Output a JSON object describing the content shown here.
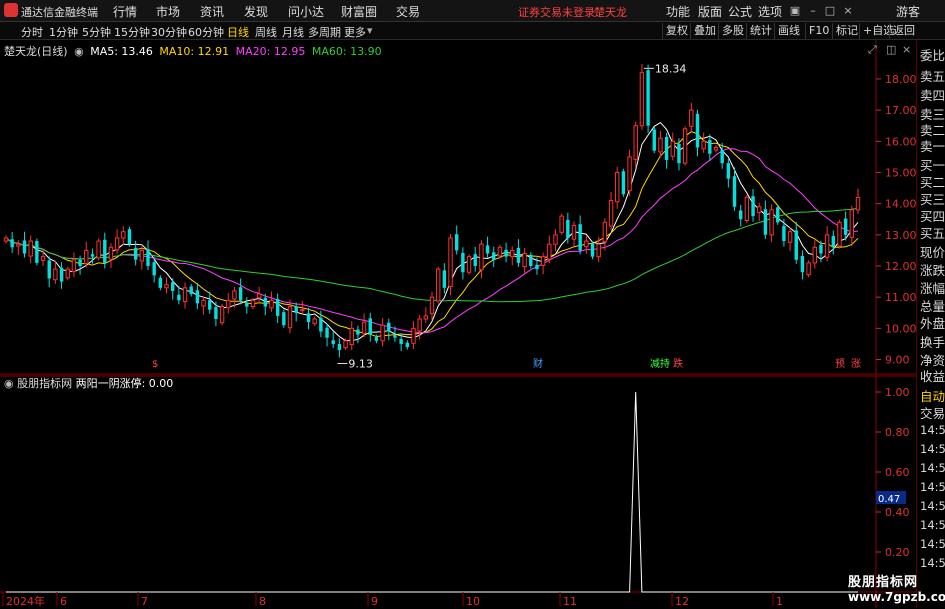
{
  "app": {
    "title": "通达信金融终端",
    "notice": "证券交易未登录",
    "stock_name": "楚天龙",
    "menu": [
      "行情",
      "市场",
      "资讯",
      "发现",
      "问小达",
      "财富圈",
      "交易"
    ],
    "right_menu": [
      "功能",
      "版面",
      "公式",
      "选项"
    ],
    "guest": "游客"
  },
  "periods": [
    "分时",
    "1分钟",
    "5分钟",
    "15分钟",
    "30分钟",
    "60分钟",
    "日线",
    "周线",
    "月线",
    "多周期",
    "更多"
  ],
  "active_period": "日线",
  "toolbar": [
    "复权",
    "叠加",
    "多股",
    "统计",
    "画线",
    "F10",
    "标记",
    "+自选",
    "返回"
  ],
  "legend": {
    "label": "楚天龙(日线)",
    "ma": [
      {
        "label": "MA5: 13.46",
        "color": "#ffffff"
      },
      {
        "label": "MA10: 12.91",
        "color": "#ffd700"
      },
      {
        "label": "MA20: 12.95",
        "color": "#ff40ff"
      },
      {
        "label": "MA60: 13.90",
        "color": "#32cd32"
      }
    ]
  },
  "price_axis": {
    "min": 8.6,
    "max": 18.8,
    "ticks": [
      "18.00",
      "17.00",
      "16.00",
      "15.00",
      "14.00",
      "13.00",
      "12.00",
      "11.00",
      "10.00",
      "9.00"
    ]
  },
  "annotations": {
    "high": "18.34",
    "low": "9.13"
  },
  "markers": [
    {
      "text": "$",
      "color": "#ff4040"
    },
    {
      "text": "财",
      "color": "#40a0ff"
    },
    {
      "text": "减持",
      "color": "#40ff40"
    },
    {
      "text": "跌",
      "color": "#ff4040"
    },
    {
      "text": "预",
      "color": "#ff4040"
    },
    {
      "text": "涨",
      "color": "#ff4040"
    }
  ],
  "indicator": {
    "name": "股朋指标网",
    "line": "两阳一阴涨停: 0.00",
    "ticks": [
      "1.00",
      "0.80",
      "0.60",
      "0.40",
      "0.20"
    ],
    "current": "0.47"
  },
  "date_axis": {
    "labels": [
      "2024年",
      "6",
      "7",
      "8",
      "9",
      "10",
      "11",
      "12",
      "1"
    ]
  },
  "right_panel": {
    "upper": [
      "委比",
      "卖五",
      "卖四",
      "卖三",
      "卖二",
      "卖一",
      "买一",
      "买二",
      "买三",
      "买四",
      "买五",
      "现价",
      "涨跌",
      "涨幅",
      "总量",
      "外盘",
      "换手",
      "净资",
      "收益"
    ],
    "lower": [
      "自动",
      "交易"
    ],
    "times": [
      "14:56",
      "14:56",
      "14:56",
      "14:56",
      "14:56",
      "14:56",
      "14:56",
      "14:56",
      "14:56"
    ]
  },
  "watermark": {
    "name": "股朋指标网",
    "url": "www.7gpzb.com"
  },
  "chart_data": {
    "type": "candlestick",
    "closes": [
      12.9,
      12.6,
      12.7,
      12.4,
      12.8,
      12.1,
      12.3,
      11.6,
      11.9,
      11.5,
      11.9,
      12.2,
      12.0,
      12.5,
      12.3,
      12.8,
      12.1,
      12.6,
      12.9,
      13.1,
      12.7,
      12.2,
      12.5,
      12.0,
      11.7,
      11.3,
      11.4,
      11.2,
      10.9,
      11.3,
      11.1,
      10.8,
      10.9,
      10.6,
      10.3,
      10.7,
      10.9,
      11.2,
      10.9,
      10.7,
      10.9,
      11.1,
      10.7,
      10.9,
      10.4,
      10.1,
      10.7,
      10.5,
      10.6,
      10.2,
      10.3,
      9.9,
      9.7,
      9.5,
      9.3,
      9.6,
      10.0,
      9.8,
      10.2,
      9.8,
      9.6,
      10.1,
      9.9,
      9.7,
      9.5,
      9.4,
      10.0,
      10.3,
      10.4,
      11.0,
      11.9,
      11.3,
      12.9,
      12.5,
      11.8,
      12.3,
      12.0,
      12.7,
      12.4,
      12.2,
      12.6,
      12.3,
      12.5,
      12.1,
      12.4,
      12.0,
      11.9,
      12.3,
      12.7,
      13.0,
      13.6,
      12.9,
      13.3,
      12.5,
      12.8,
      12.3,
      12.7,
      13.4,
      14.1,
      15.0,
      14.3,
      15.5,
      16.5,
      18.2,
      16.5,
      15.7,
      16.1,
      15.4,
      16.0,
      15.3,
      16.4,
      17.0,
      15.8,
      16.0,
      15.6,
      15.8,
      15.3,
      14.8,
      13.9,
      13.5,
      14.2,
      13.6,
      13.9,
      13.0,
      13.8,
      13.4,
      12.8,
      13.1,
      12.2,
      11.8,
      12.1,
      12.6,
      12.4,
      13.0,
      12.6,
      13.4,
      13.0,
      13.8,
      14.2
    ],
    "high": 18.34,
    "low": 9.13,
    "indicator_spike": 1.0
  }
}
